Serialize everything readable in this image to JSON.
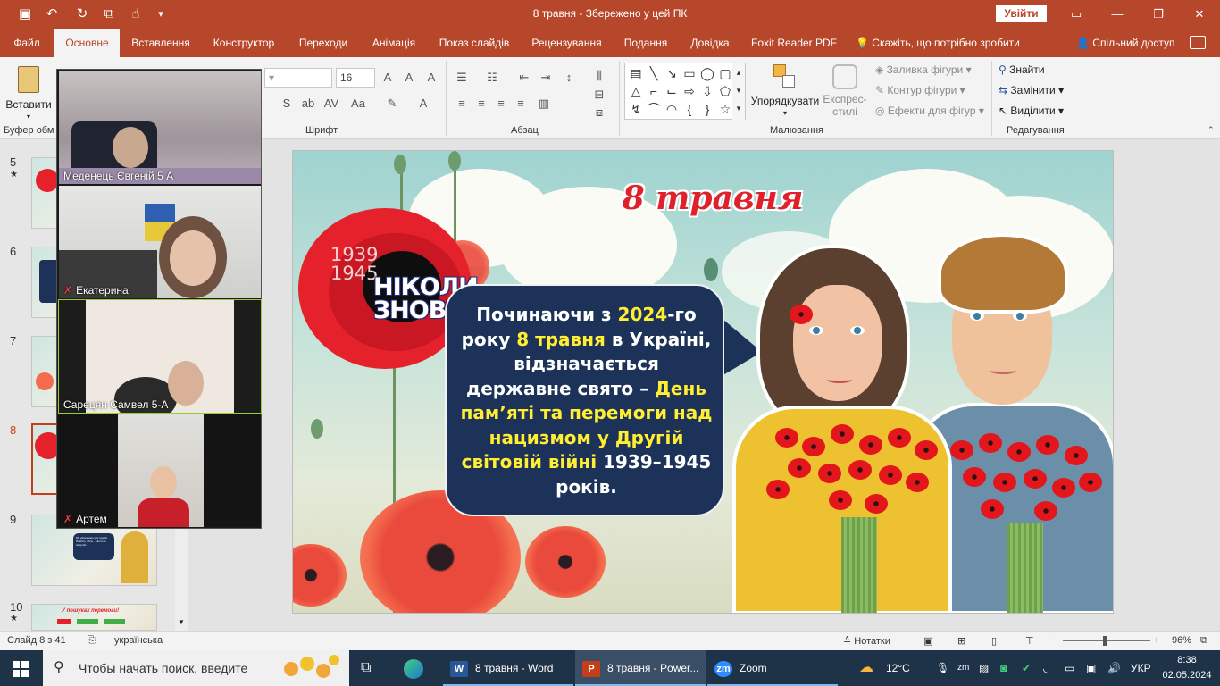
{
  "window": {
    "title": "8 травня  -  Збережено у цей ПК",
    "sign_in": "Увійти",
    "controls": {
      "ribbon_display": "▭",
      "minimize": "—",
      "maximize": "❐",
      "close": "✕"
    }
  },
  "quick_access": [
    {
      "name": "save-icon",
      "glyph": "▣"
    },
    {
      "name": "undo-icon",
      "glyph": "↶"
    },
    {
      "name": "redo-icon",
      "glyph": "↻"
    },
    {
      "name": "present-icon",
      "glyph": "⧉"
    },
    {
      "name": "touch-mode-icon",
      "glyph": "☝"
    },
    {
      "name": "customize-icon",
      "glyph": "▾"
    }
  ],
  "tabs": [
    "Файл",
    "Основне",
    "Вставлення",
    "Конструктор",
    "Переходи",
    "Анімація",
    "Показ слайдів",
    "Рецензування",
    "Подання",
    "Довідка",
    "Foxit Reader PDF"
  ],
  "active_tab": "Основне",
  "tell_me": "Скажіть, що потрібно зробити",
  "share": "Спільний доступ",
  "ribbon": {
    "paste_label": "Вставити",
    "clipboard_label": "Буфер обм",
    "font_label": "Шрифт",
    "font_size": "16",
    "paragraph_label": "Абзац",
    "drawing_label": "Малювання",
    "editing_label": "Редагування",
    "arrange_label": "Упорядкувати",
    "quick_styles_label": "Експрес-стилі",
    "shape_fill": "Заливка фігури",
    "shape_outline": "Контур фігури",
    "shape_effects": "Ефекти для фігур",
    "find": "Знайти",
    "replace": "Замінити",
    "select": "Виділити"
  },
  "thumbnails": [
    {
      "num": "5",
      "star": "★"
    },
    {
      "num": "6",
      "star": ""
    },
    {
      "num": "7",
      "star": ""
    },
    {
      "num": "8",
      "star": ""
    },
    {
      "num": "9",
      "star": ""
    },
    {
      "num": "10",
      "star": "★"
    }
  ],
  "thumb_texts": {
    "slide9": "Ми увічнюємо усіх героїв. Пам'ять і біль... Ніхто не забутий...",
    "slide10": "У пошуках перемоги!"
  },
  "zoom_participants": [
    {
      "name": "Меденець Євгеній 5 А",
      "muted": false
    },
    {
      "name": "Екатерина",
      "muted": true
    },
    {
      "name": "Сарецян Самвел 5-А",
      "muted": false
    },
    {
      "name": "Артем",
      "muted": true
    }
  ],
  "slide": {
    "title": "8 травня",
    "logo_years": [
      "1939",
      "1945"
    ],
    "logo_text": [
      "НІКОЛИ",
      "ЗНОВУ"
    ],
    "bubble": {
      "w1": "Починаючи з ",
      "y1": "2024",
      "w2": "-го року  ",
      "y2": "8 травня",
      "w3": " в Україні, відзначається державне свято – ",
      "y3": "День пам’яті та перемоги над нацизмом у Другій світовій війні",
      "w4": " 1939–1945 років."
    }
  },
  "status": {
    "slide": "Слайд 8 з 41",
    "language": "українська",
    "notes": "Нотатки",
    "zoom": "96%",
    "zoom_fraction": 0.48
  },
  "taskbar": {
    "search": "Чтобы начать поиск, введите",
    "apps": [
      {
        "label": "8 травня - Word",
        "icon": "W",
        "color": "#2b5797"
      },
      {
        "label": "8 травня - Power...",
        "icon": "P",
        "color": "#c43e1c"
      },
      {
        "label": "Zoom",
        "icon": "zm",
        "color": "#2d8cff"
      }
    ],
    "weather": "12°C",
    "lang": "УКР",
    "time": "8:38",
    "date": "02.05.2024"
  },
  "colors": {
    "accent": "#b7472a",
    "current_slide": "#c43e1c",
    "title_red": "#e0202b",
    "bubble_bg": "#1c3258",
    "highlight": "#ffee33"
  }
}
